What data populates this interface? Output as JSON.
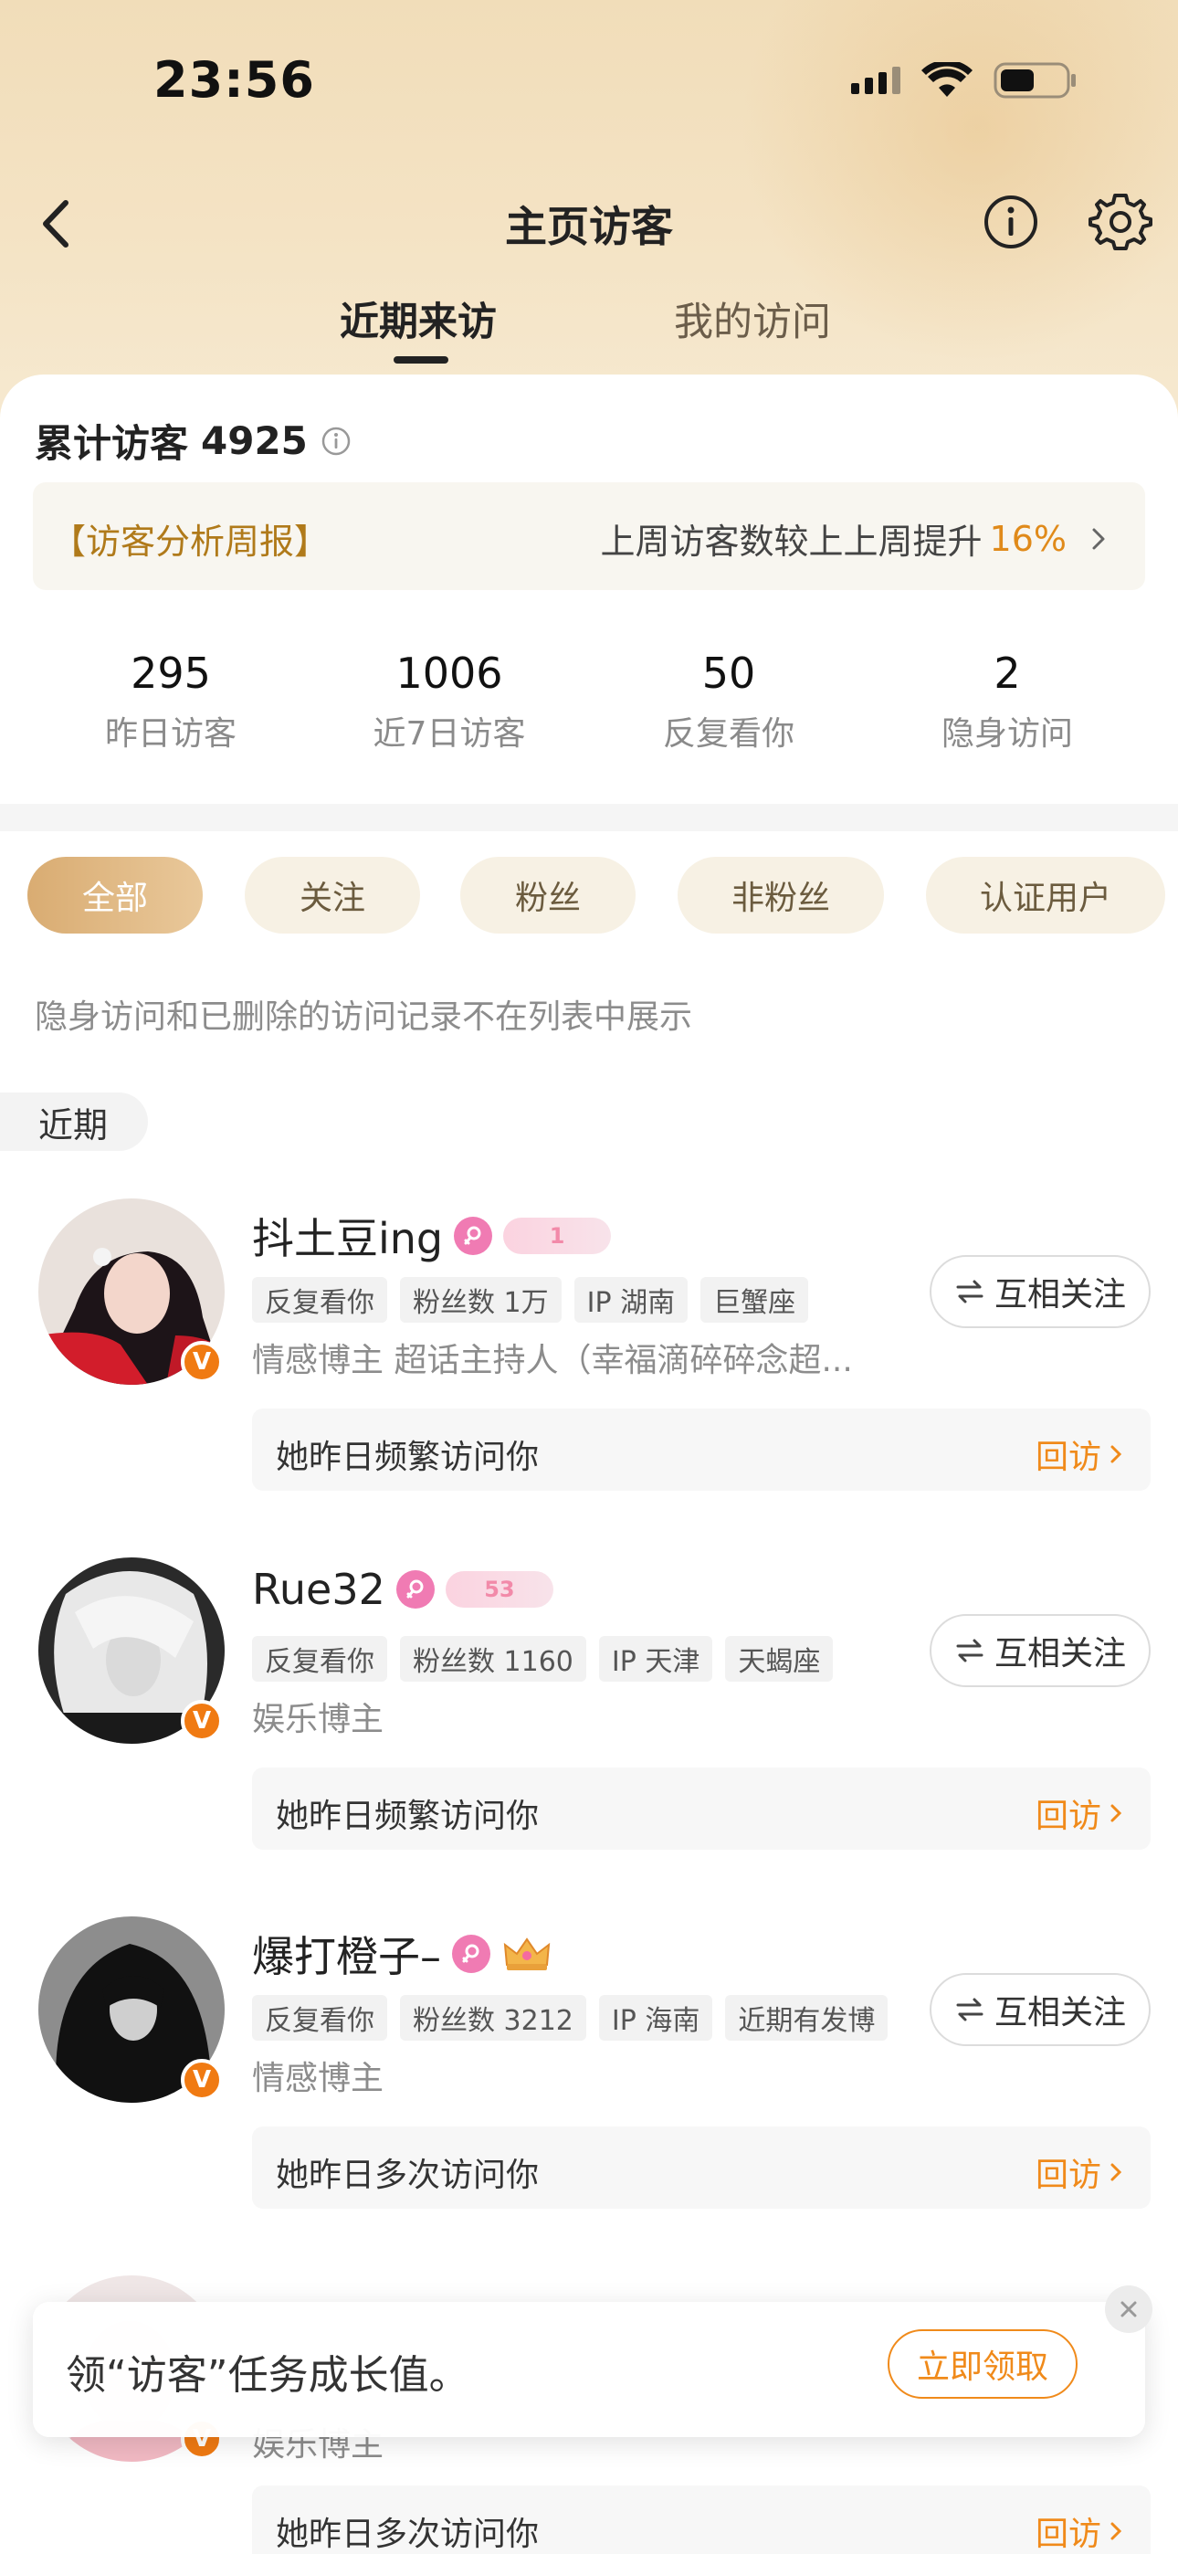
{
  "status_bar": {
    "time": "23:56"
  },
  "nav": {
    "title": "主页访客"
  },
  "tabs": [
    {
      "label": "近期来访"
    },
    {
      "label": "我的访问"
    }
  ],
  "summary": {
    "total_label": "累计访客",
    "total_value": "4925",
    "weekly_left": "【访客分析周报】",
    "weekly_text": "上周访客数较上上周提升",
    "weekly_pct": "16%"
  },
  "stats": [
    {
      "value": "295",
      "label": "昨日访客"
    },
    {
      "value": "1006",
      "label": "近7日访客"
    },
    {
      "value": "50",
      "label": "反复看你"
    },
    {
      "value": "2",
      "label": "隐身访问"
    }
  ],
  "filters": [
    {
      "label": "全部"
    },
    {
      "label": "关注"
    },
    {
      "label": "粉丝"
    },
    {
      "label": "非粉丝"
    },
    {
      "label": "认证用户"
    }
  ],
  "note": "隐身访问和已删除的访问记录不在列表中展示",
  "section": "近期",
  "visitors": [
    {
      "name": "抖土豆ing",
      "level": "1",
      "tags": [
        "反复看你",
        "粉丝数 1万",
        "IP 湖南",
        "巨蟹座"
      ],
      "desc": "情感博主 超话主持人（幸福滴碎碎念超...",
      "follow": "互相关注",
      "visit_text": "她昨日频繁访问你",
      "revisit": "回访"
    },
    {
      "name": "Rue32",
      "level": "53",
      "tags": [
        "反复看你",
        "粉丝数 1160",
        "IP 天津",
        "天蝎座"
      ],
      "desc": "娱乐博主",
      "follow": "互相关注",
      "visit_text": "她昨日频繁访问你",
      "revisit": "回访"
    },
    {
      "name": "爆打橙子–",
      "tags": [
        "反复看你",
        "粉丝数 3212",
        "IP 海南",
        "近期有发博"
      ],
      "desc": "情感博主",
      "follow": "互相关注",
      "visit_text": "她昨日多次访问你",
      "revisit": "回访"
    },
    {
      "desc": "娱乐博主",
      "visit_text": "她昨日多次访问你",
      "revisit": "回访"
    }
  ],
  "banner": {
    "text": "领“访客”任务成长值。",
    "button": "立即领取"
  },
  "colors": {
    "accent": "#f08a1a",
    "gold": "#b07a1a",
    "chip_active": "#d9ac72"
  }
}
